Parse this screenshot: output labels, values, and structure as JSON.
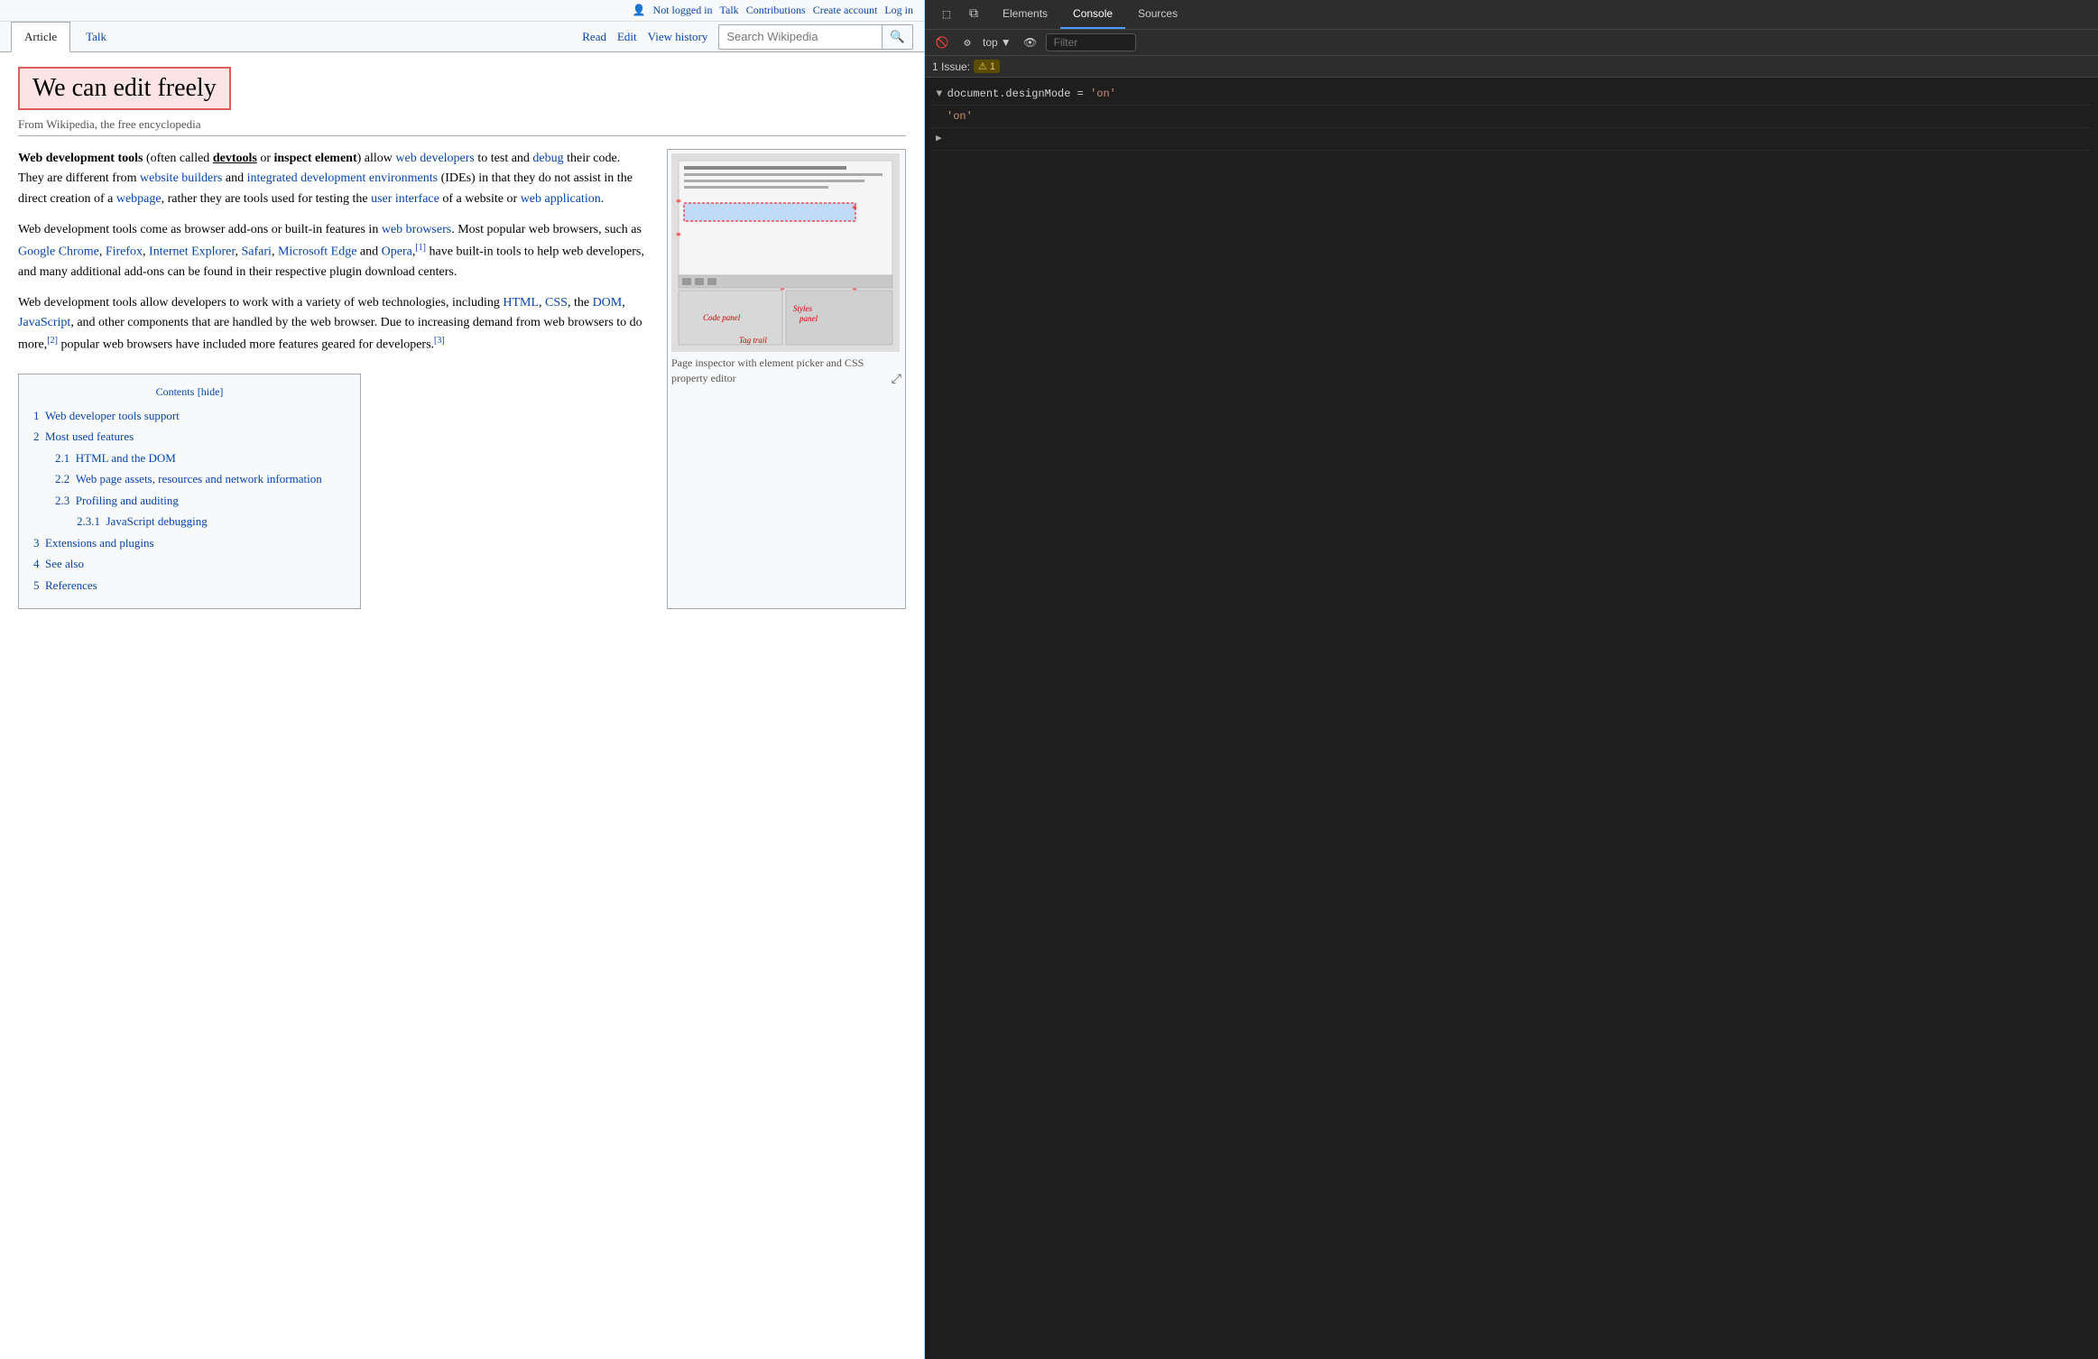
{
  "wiki": {
    "topbar": {
      "not_logged_in": "Not logged in",
      "talk": "Talk",
      "contributions": "Contributions",
      "create_account": "Create account",
      "log_in": "Log in"
    },
    "tabs": {
      "article": "Article",
      "talk": "Talk",
      "read": "Read",
      "edit": "Edit",
      "view_history": "View history"
    },
    "search": {
      "placeholder": "Search Wikipedia"
    },
    "page": {
      "title": "We can edit freely",
      "subtitle": "From Wikipedia, the free encyclopedia"
    },
    "article": {
      "para1_parts": {
        "before": "Web development tools",
        "paren": "(often called ",
        "devtools": "devtools",
        "or": " or ",
        "inspect": "inspect element",
        "after1": ") allow ",
        "web_devs": "web developers",
        "after2": " to test and ",
        "debug": "debug",
        "after3": " their code. They are different from ",
        "website_builders": "website builders",
        "after4": " and ",
        "ide": "integrated development environments",
        "after5": " (IDEs) in that they do not assist in the direct creation of a ",
        "webpage": "webpage",
        "after6": ", rather they are tools used for testing the ",
        "ui": "user interface",
        "after7": " of a website or ",
        "webapp": "web application",
        "end": "."
      },
      "para2": "Web development tools come as browser add-ons or built-in features in",
      "web_browsers": "web browsers",
      "para2b": ". Most popular web browsers, such as",
      "chrome": "Google Chrome",
      "firefox": "Firefox",
      "ie": "Internet Explorer",
      "safari": "Safari",
      "edge": "Microsoft Edge",
      "and": "and",
      "opera": "Opera",
      "ref1": "[1]",
      "para2c": " have built-in tools to help web developers, and many additional add-ons can be found in their respective plugin download centers.",
      "para3": "Web development tools allow developers to work with a variety of web technologies, including",
      "html": "HTML",
      "css": "CSS",
      "dom": "DOM",
      "javascript": "JavaScript",
      "para3b": ", and other components that are handled by the web browser. Due to increasing demand from web browsers to do more,",
      "ref2": "[2]",
      "para3c": " popular web browsers have included more features geared for developers.",
      "ref3": "[3]"
    },
    "image": {
      "caption": "Page inspector with element picker and CSS property editor",
      "labels": {
        "code_panel": "Code panel",
        "styles_panel": "Styles panel",
        "tag_trail": "Tag trail"
      }
    },
    "contents": {
      "title": "Contents",
      "hide": "[hide]",
      "items": [
        {
          "num": "1",
          "label": "Web developer tools support",
          "indent": 0
        },
        {
          "num": "2",
          "label": "Most used features",
          "indent": 0
        },
        {
          "num": "2.1",
          "label": "HTML and the DOM",
          "indent": 1
        },
        {
          "num": "2.2",
          "label": "Web page assets, resources and network information",
          "indent": 1
        },
        {
          "num": "2.3",
          "label": "Profiling and auditing",
          "indent": 1
        },
        {
          "num": "2.3.1",
          "label": "JavaScript debugging",
          "indent": 2
        },
        {
          "num": "3",
          "label": "Extensions and plugins",
          "indent": 0
        },
        {
          "num": "4",
          "label": "See also",
          "indent": 0
        },
        {
          "num": "5",
          "label": "References",
          "indent": 0
        }
      ]
    }
  },
  "devtools": {
    "tabs": [
      "Elements",
      "Console",
      "Sources"
    ],
    "active_tab": "Console",
    "toolbar2": {
      "dropdown_label": "top",
      "filter_placeholder": "Filter"
    },
    "issues_bar": {
      "label": "1 Issue:",
      "count": "1"
    },
    "console_lines": [
      {
        "type": "expand",
        "expanded": true,
        "code": "document.designMode = 'on'"
      },
      {
        "type": "indent",
        "code": "'on'"
      },
      {
        "type": "expand",
        "expanded": false,
        "code": ""
      }
    ]
  }
}
